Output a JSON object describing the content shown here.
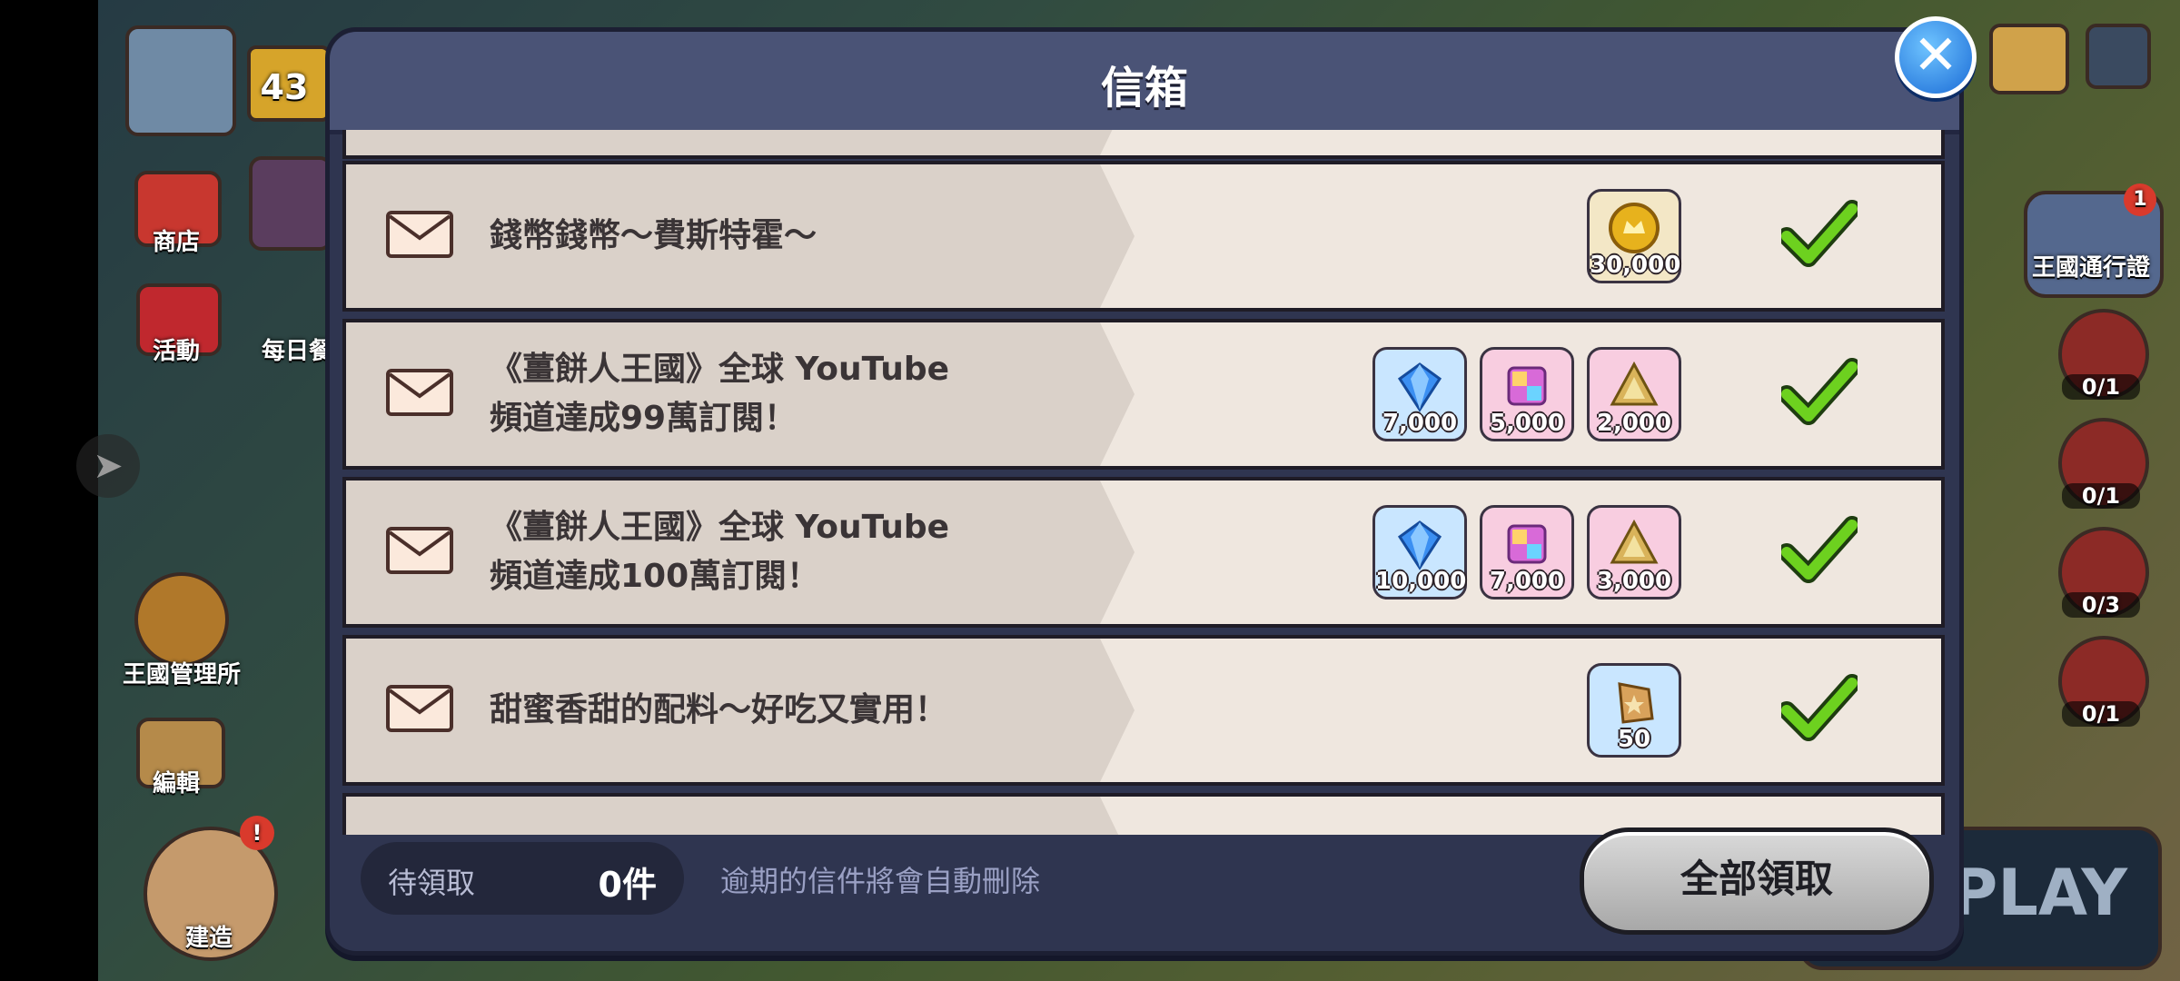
{
  "modal": {
    "title": "信箱",
    "close_icon": "close-icon"
  },
  "hud": {
    "level": "43",
    "shop_label": "商店",
    "event_label": "活動",
    "daily_label": "每日餐",
    "kingdom_mgmt_label": "王國管理所",
    "edit_label": "編輯",
    "build_label": "建造",
    "pass_label": "王國通行證",
    "pass_badge": "1",
    "build_badge": "!",
    "quests": [
      "0/1",
      "0/1",
      "0/3",
      "0/1"
    ],
    "play_label": "PLAY"
  },
  "mails": [
    {
      "title_lines": [
        "錢幣錢幣～費斯特霍～"
      ],
      "rewards": [
        {
          "icon": "coin-icon",
          "color": "gold",
          "qty": "30,000"
        }
      ]
    },
    {
      "title_lines": [
        "《薑餅人王國》全球 YouTube",
        "頻道達成99萬訂閱！"
      ],
      "rewards": [
        {
          "icon": "crystal-icon",
          "color": "blue",
          "qty": "7,000"
        },
        {
          "icon": "rainbow-cube-icon",
          "color": "pink",
          "qty": "5,000"
        },
        {
          "icon": "soulstone-icon",
          "color": "pink",
          "qty": "2,000"
        }
      ]
    },
    {
      "title_lines": [
        "《薑餅人王國》全球 YouTube",
        "頻道達成100萬訂閱！"
      ],
      "rewards": [
        {
          "icon": "crystal-icon",
          "color": "blue",
          "qty": "10,000"
        },
        {
          "icon": "rainbow-cube-icon",
          "color": "pink",
          "qty": "7,000"
        },
        {
          "icon": "soulstone-icon",
          "color": "pink",
          "qty": "3,000"
        }
      ]
    },
    {
      "title_lines": [
        "甜蜜香甜的配料～好吃又實用！"
      ],
      "rewards": [
        {
          "icon": "topping-piece-icon",
          "color": "blue",
          "qty": "50"
        }
      ]
    }
  ],
  "footer": {
    "pending_label": "待領取",
    "pending_count": "0件",
    "notice": "逾期的信件將會自動刪除",
    "claim_all_label": "全部領取"
  },
  "colors": {
    "modal_bg": "#2f3550",
    "header_bg": "#4a5376",
    "row_bg": "#efe7df",
    "check": "#6dd11f",
    "close_button": "#1a6bd6"
  }
}
